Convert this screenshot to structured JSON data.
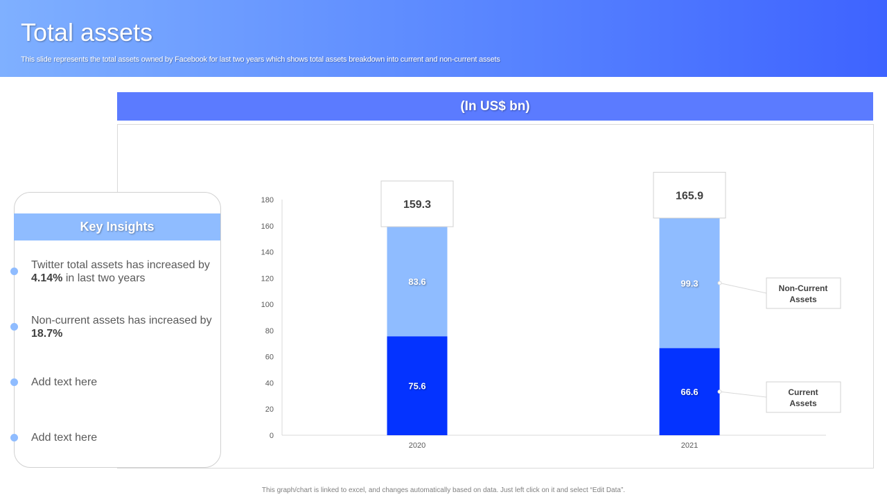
{
  "header": {
    "title": "Total assets",
    "subtitle": "This slide represents the total assets owned by Facebook for last two years which shows total assets breakdown into current and non-current assets"
  },
  "unit_label": "(In US$ bn)",
  "insights": {
    "title": "Key Insights",
    "items": [
      {
        "pre": "Twitter total assets has increased by ",
        "bold": "4.14%",
        "post": " in last two years"
      },
      {
        "pre": "Non-current  assets has increased by ",
        "bold": "18.7%",
        "post": ""
      },
      {
        "pre": "Add text here",
        "bold": "",
        "post": ""
      },
      {
        "pre": "Add text here",
        "bold": "",
        "post": ""
      }
    ]
  },
  "footer": "This graph/chart is linked to excel, and changes automatically based on data. Just left click on it and select “Edit Data”.",
  "colors": {
    "current": "#0433ff",
    "non_current": "#8fbcff",
    "accent": "#5b7bff"
  },
  "chart_data": {
    "type": "bar",
    "stacked": true,
    "categories": [
      "2020",
      "2021"
    ],
    "series": [
      {
        "name": "Current Assets",
        "values": [
          75.6,
          66.6
        ]
      },
      {
        "name": "Non-Current Assets",
        "values": [
          83.6,
          99.3
        ]
      }
    ],
    "totals": [
      159.3,
      165.9
    ],
    "ylim": [
      0,
      180
    ],
    "yticks": [
      0,
      20,
      40,
      60,
      80,
      100,
      120,
      140,
      160,
      180
    ],
    "legend_placement": "right",
    "grid": false
  }
}
